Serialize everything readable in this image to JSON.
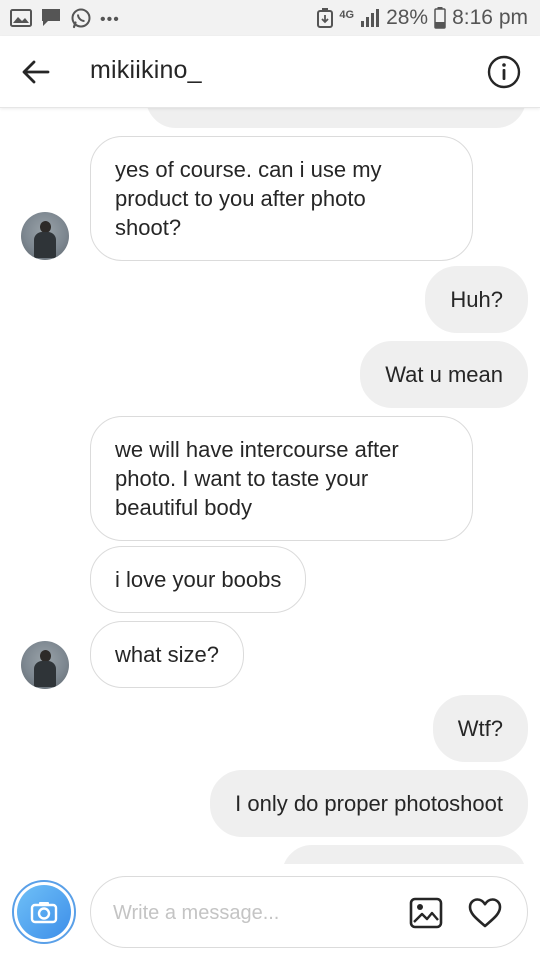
{
  "status_bar": {
    "network": "4G",
    "battery": "28%",
    "time": "8:16 pm",
    "left_icons": [
      "gallery-icon",
      "chat-icon",
      "whatsapp-icon",
      "more-dots-icon"
    ],
    "right_icons": [
      "download-icon",
      "signal-icon",
      "battery-icon"
    ]
  },
  "header": {
    "title": "mikiikino_",
    "back_icon": "arrow-left-icon",
    "info_icon": "info-icon"
  },
  "messages": [
    {
      "direction": "in",
      "text": "yes of course. can i use my product to you after photo shoot?",
      "lines": [
        "yes of course. can i use my",
        "product to you after photo",
        "shoot?"
      ],
      "avatar": true
    },
    {
      "direction": "out",
      "text": "Huh?"
    },
    {
      "direction": "out",
      "text": "Wat u mean"
    },
    {
      "direction": "in",
      "text": "we will have intercourse after photo. I want to taste your beautiful body",
      "lines": [
        "we will have intercourse after",
        "photo. I want to taste your",
        "beautiful body"
      ],
      "avatar": false
    },
    {
      "direction": "in",
      "text": "i love your boobs",
      "avatar": false
    },
    {
      "direction": "in",
      "text": "what size?",
      "avatar": true
    },
    {
      "direction": "out",
      "text": "Wtf?"
    },
    {
      "direction": "out",
      "text": "I only do proper photoshoot"
    }
  ],
  "composer": {
    "placeholder": "Write a message...",
    "camera_icon": "camera-icon",
    "gallery_icon": "image-icon",
    "heart_icon": "heart-icon"
  },
  "colors": {
    "incoming_bubble_border": "#dbdbdb",
    "outgoing_bubble_bg": "#efefef",
    "camera_blue": "#3d8ee9",
    "status_bar_bg": "#f2f2f2",
    "placeholder": "#c4c4c4"
  }
}
